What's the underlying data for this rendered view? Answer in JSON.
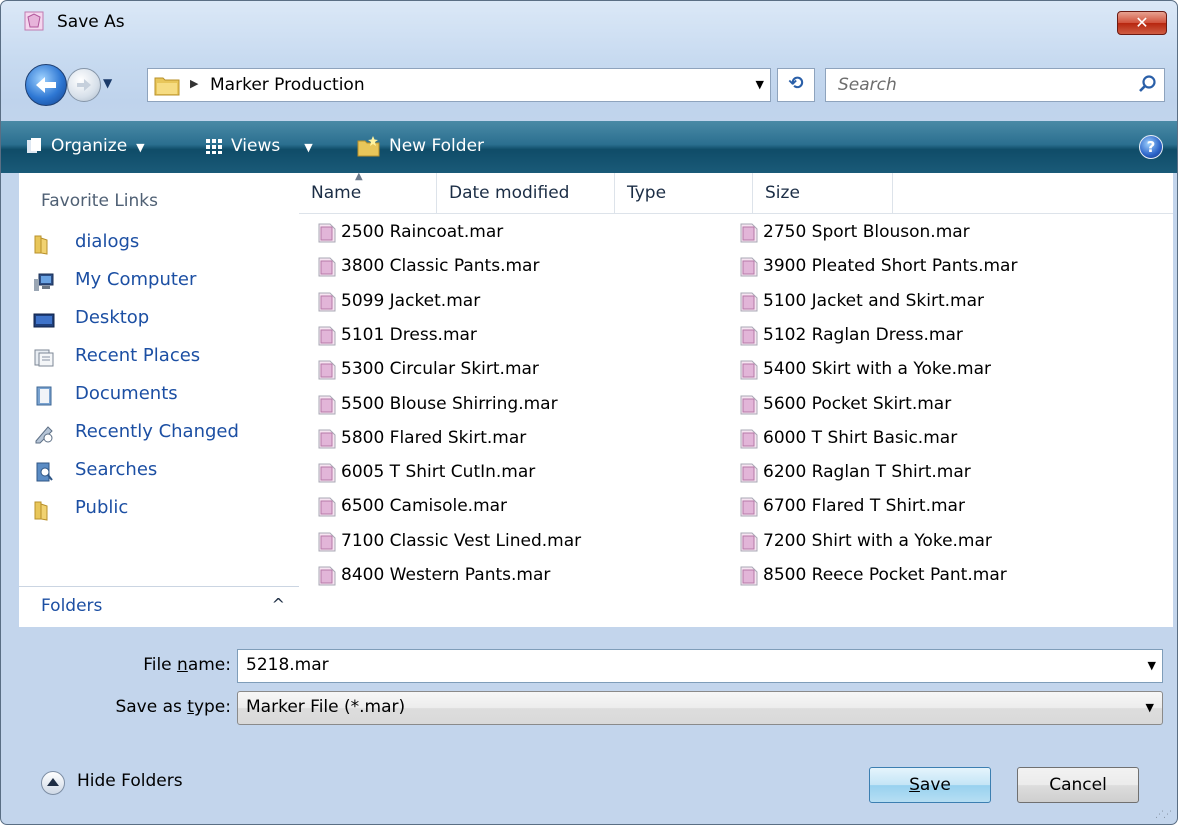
{
  "window": {
    "title": "Save As",
    "close_label": "✕"
  },
  "nav": {
    "breadcrumb": "Marker Production",
    "refresh_glyph": "⟲",
    "search_placeholder": "Search"
  },
  "toolbar": {
    "organize": "Organize",
    "views": "Views",
    "new_folder": "New Folder",
    "help": "?"
  },
  "sidebar": {
    "title": "Favorite Links",
    "items": [
      {
        "label": "dialogs",
        "icon": "folder-icon"
      },
      {
        "label": "My Computer",
        "icon": "computer-icon"
      },
      {
        "label": "Desktop",
        "icon": "desktop-icon"
      },
      {
        "label": "Recent Places",
        "icon": "recent-places-icon"
      },
      {
        "label": "Documents",
        "icon": "documents-icon"
      },
      {
        "label": "Recently Changed",
        "icon": "recently-changed-icon"
      },
      {
        "label": "Searches",
        "icon": "searches-icon"
      },
      {
        "label": "Public",
        "icon": "folder-icon"
      }
    ],
    "folders_label": "Folders",
    "folders_toggle": "^"
  },
  "file_list": {
    "columns": [
      "Name",
      "Date modified",
      "Type",
      "Size"
    ],
    "files_col1": [
      "2500 Raincoat.mar",
      "3800 Classic Pants.mar",
      "5099 Jacket.mar",
      "5101 Dress.mar",
      "5300 Circular Skirt.mar",
      "5500 Blouse Shirring.mar",
      "5800 Flared Skirt.mar",
      "6005 T Shirt CutIn.mar",
      "6500 Camisole.mar",
      "7100 Classic Vest Lined.mar",
      "8400 Western Pants.mar"
    ],
    "files_col2": [
      "2750 Sport Blouson.mar",
      "3900 Pleated Short Pants.mar",
      "5100 Jacket and Skirt.mar",
      "5102 Raglan Dress.mar",
      "5400 Skirt with a Yoke.mar",
      "5600 Pocket Skirt.mar",
      "6000 T Shirt Basic.mar",
      "6200 Raglan T Shirt.mar",
      "6700 Flared T Shirt.mar",
      "7200 Shirt with a Yoke.mar",
      "8500 Reece Pocket Pant.mar"
    ]
  },
  "form": {
    "file_name_label_pre": "File ",
    "file_name_label_u": "n",
    "file_name_label_post": "ame:",
    "file_name_value": "5218.mar",
    "save_type_label_pre": "Save as ",
    "save_type_label_u": "t",
    "save_type_label_post": "ype:",
    "save_type_value": "Marker File (*.mar)"
  },
  "footer": {
    "hide_folders": "Hide Folders",
    "save_u": "S",
    "save_rest": "ave",
    "cancel": "Cancel"
  },
  "colors": {
    "toolbar": "#1a5a78",
    "link": "#1c4fa3",
    "accent_button": "#98d1ef"
  }
}
